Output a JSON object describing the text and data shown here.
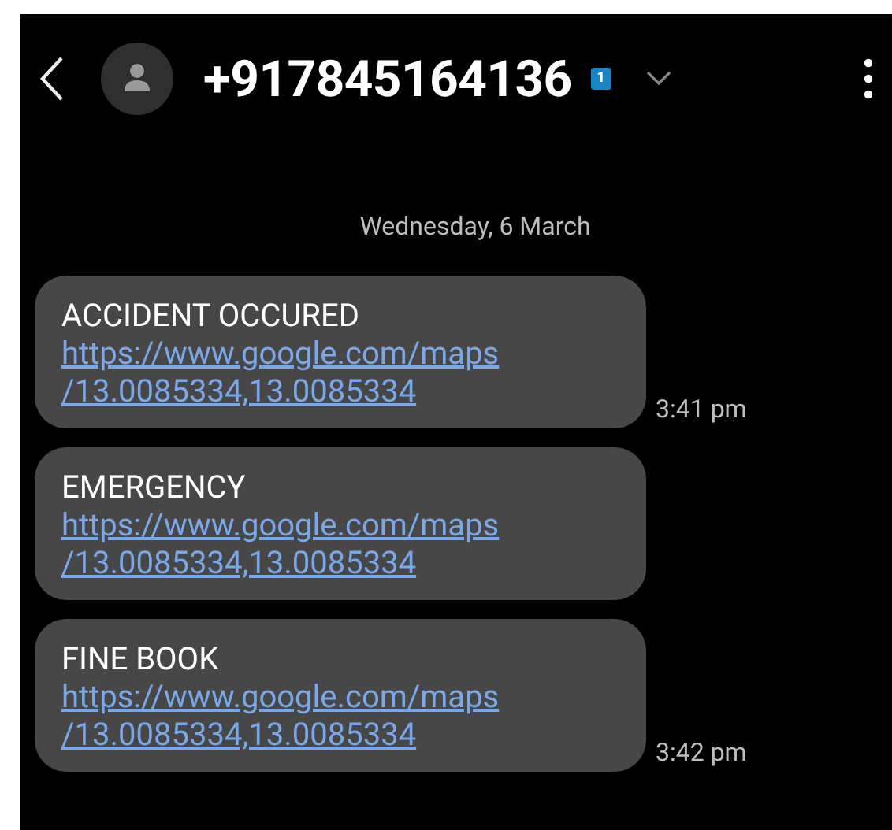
{
  "header": {
    "contact": "+917845164136",
    "sim_badge": "1"
  },
  "date_divider": "Wednesday, 6 March",
  "messages": [
    {
      "text": "ACCIDENT OCCURED",
      "link_lines": [
        "https://www.google.com/maps",
        "/13.0085334,13.0085334"
      ],
      "time": "3:41 pm"
    },
    {
      "text": "EMERGENCY",
      "link_lines": [
        "https://www.google.com/maps",
        "/13.0085334,13.0085334"
      ]
    },
    {
      "text": "FINE BOOK",
      "link_lines": [
        "https://www.google.com/maps",
        "/13.0085334,13.0085334"
      ],
      "time": "3:42 pm"
    }
  ]
}
